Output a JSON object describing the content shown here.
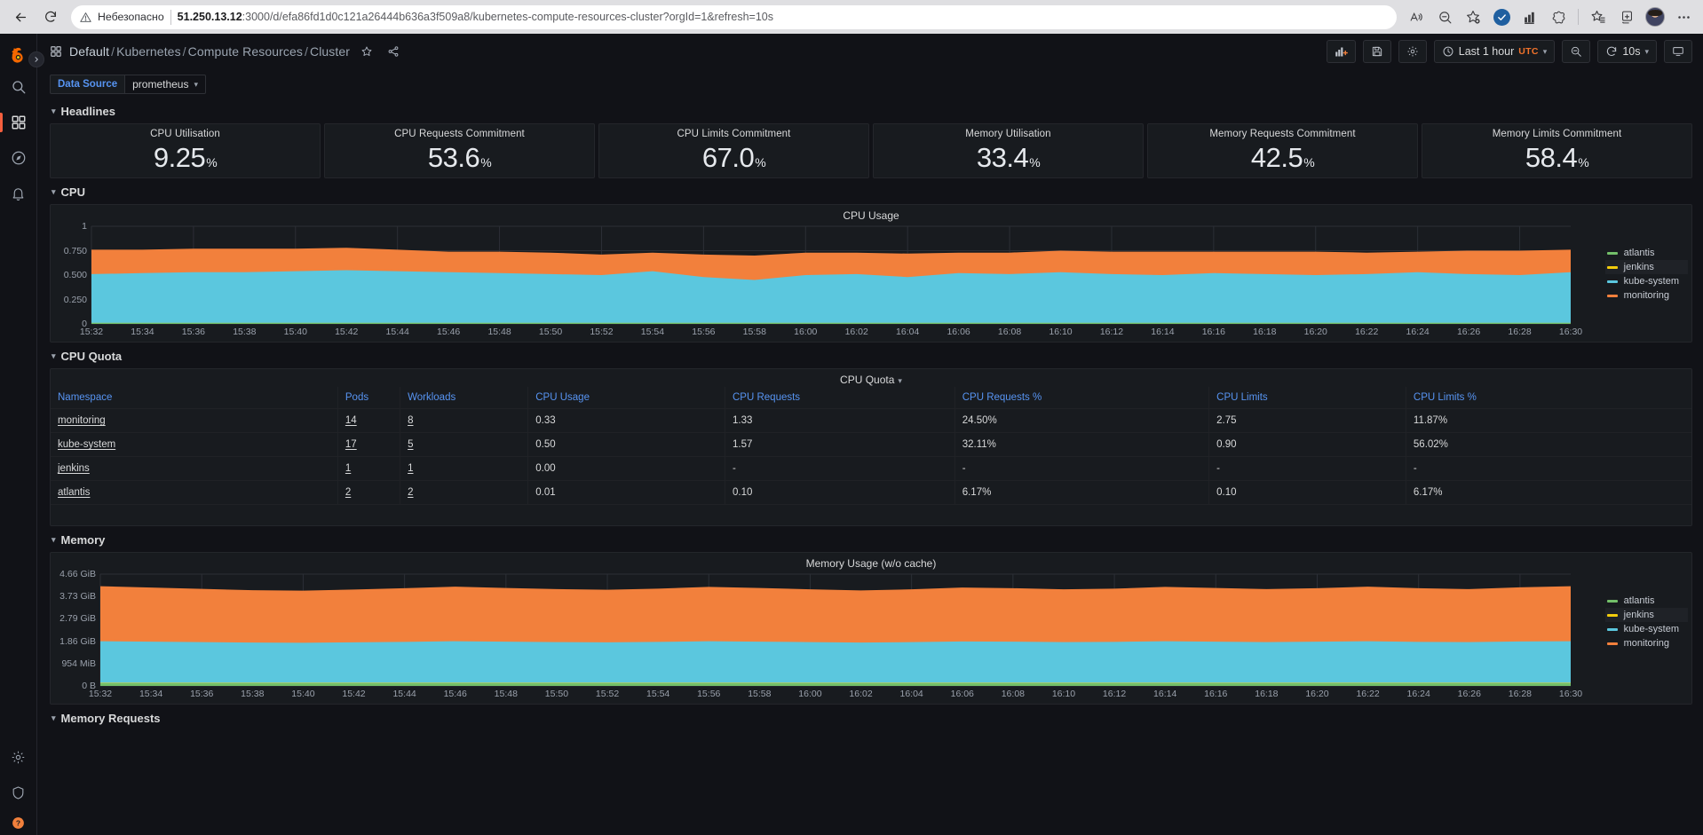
{
  "browser": {
    "insecure_label": "Небезопасно",
    "url_host": "51.250.13.12",
    "url_rest": ":3000/d/efa86fd1d0c121a26444b636a3f509a8/kubernetes-compute-resources-cluster?orgId=1&refresh=10s",
    "back_icon": "back-arrow-icon",
    "reload_icon": "reload-icon",
    "read_aloud_icon": "read-aloud-icon",
    "zoom_out_icon": "zoom-out-icon",
    "favorite_icon": "add-favorite-icon",
    "shield_icon": "tracking-prevention-icon",
    "collections_icon": "collections-icon",
    "browser_essentials_icon": "browser-essentials-icon",
    "split_screen_icon": "split-screen-icon",
    "profile_icon": "profile-avatar",
    "settings_icon": "settings-and-more-icon"
  },
  "sidebar": {
    "logo": "grafana-logo-icon",
    "expand_icon": "expand-menu-chevron-icon",
    "items": [
      {
        "name": "search",
        "icon": "search-icon",
        "active": false
      },
      {
        "name": "dashboards",
        "icon": "dashboards-grid-icon",
        "active": true
      },
      {
        "name": "explore",
        "icon": "compass-icon",
        "active": false
      },
      {
        "name": "alerting",
        "icon": "bell-icon",
        "active": false
      }
    ],
    "bottom_items": [
      {
        "name": "configuration",
        "icon": "gear-icon"
      },
      {
        "name": "server-admin",
        "icon": "shield-icon"
      },
      {
        "name": "help",
        "icon": "help-icon"
      }
    ]
  },
  "header": {
    "breadcrumb_icon": "dashboard-grid-icon",
    "breadcrumbs": [
      "Default",
      "Kubernetes",
      "Compute Resources",
      "Cluster"
    ],
    "star_icon": "star-icon",
    "share_icon": "share-icon",
    "toolbar": {
      "add_panel_icon": "add-panel-icon",
      "save_icon": "save-dashboard-icon",
      "settings_icon": "dashboard-settings-icon",
      "time_icon": "clock-icon",
      "time_range": "Last 1 hour",
      "timezone": "UTC",
      "zoom_out_icon": "zoom-out-time-icon",
      "refresh_icon": "refresh-icon",
      "refresh_interval": "10s",
      "tv_icon": "kiosk-mode-icon"
    }
  },
  "submenu": {
    "datasource_label": "Data Source",
    "datasource_value": "prometheus"
  },
  "rows": {
    "headlines": "Headlines",
    "cpu": "CPU",
    "cpu_quota": "CPU Quota",
    "memory": "Memory",
    "memory_requests": "Memory Requests"
  },
  "stats": [
    {
      "title": "CPU Utilisation",
      "value": "9.25",
      "unit": "%"
    },
    {
      "title": "CPU Requests Commitment",
      "value": "53.6",
      "unit": "%"
    },
    {
      "title": "CPU Limits Commitment",
      "value": "67.0",
      "unit": "%"
    },
    {
      "title": "Memory Utilisation",
      "value": "33.4",
      "unit": "%"
    },
    {
      "title": "Memory Requests Commitment",
      "value": "42.5",
      "unit": "%"
    },
    {
      "title": "Memory Limits Commitment",
      "value": "58.4",
      "unit": "%"
    }
  ],
  "cpu_table": {
    "title": "CPU Quota",
    "menu_icon": "panel-menu-chevron-icon",
    "columns": [
      "Namespace",
      "Pods",
      "Workloads",
      "CPU Usage",
      "CPU Requests",
      "CPU Requests %",
      "CPU Limits",
      "CPU Limits %"
    ],
    "rows": [
      {
        "namespace": "monitoring",
        "pods": "14",
        "workloads": "8",
        "cpu_usage": "0.33",
        "cpu_requests": "1.33",
        "cpu_requests_pct": "24.50%",
        "cpu_limits": "2.75",
        "cpu_limits_pct": "11.87%"
      },
      {
        "namespace": "kube-system",
        "pods": "17",
        "workloads": "5",
        "cpu_usage": "0.50",
        "cpu_requests": "1.57",
        "cpu_requests_pct": "32.11%",
        "cpu_limits": "0.90",
        "cpu_limits_pct": "56.02%"
      },
      {
        "namespace": "jenkins",
        "pods": "1",
        "workloads": "1",
        "cpu_usage": "0.00",
        "cpu_requests": "-",
        "cpu_requests_pct": "-",
        "cpu_limits": "-",
        "cpu_limits_pct": "-"
      },
      {
        "namespace": "atlantis",
        "pods": "2",
        "workloads": "2",
        "cpu_usage": "0.01",
        "cpu_requests": "0.10",
        "cpu_requests_pct": "6.17%",
        "cpu_limits": "0.10",
        "cpu_limits_pct": "6.17%"
      }
    ]
  },
  "chart_data": [
    {
      "id": "cpu_usage",
      "type": "area",
      "title": "CPU Usage",
      "xlabel": "",
      "ylabel": "",
      "ylim": [
        0,
        1
      ],
      "yticks": [
        "0",
        "0.250",
        "0.500",
        "0.750",
        "1"
      ],
      "ytick_values": [
        0,
        0.25,
        0.5,
        0.75,
        1
      ],
      "grid": true,
      "legend_position": "right",
      "stacked": true,
      "x": [
        "15:32",
        "15:34",
        "15:36",
        "15:38",
        "15:40",
        "15:42",
        "15:44",
        "15:46",
        "15:48",
        "15:50",
        "15:52",
        "15:54",
        "15:56",
        "15:58",
        "16:00",
        "16:02",
        "16:04",
        "16:06",
        "16:08",
        "16:10",
        "16:12",
        "16:14",
        "16:16",
        "16:18",
        "16:20",
        "16:22",
        "16:24",
        "16:26",
        "16:28",
        "16:30"
      ],
      "series": [
        {
          "name": "atlantis",
          "color": "#73bf69",
          "values": [
            0.01,
            0.01,
            0.01,
            0.01,
            0.01,
            0.01,
            0.01,
            0.01,
            0.01,
            0.01,
            0.01,
            0.01,
            0.01,
            0.01,
            0.01,
            0.01,
            0.01,
            0.01,
            0.01,
            0.01,
            0.01,
            0.01,
            0.01,
            0.01,
            0.01,
            0.01,
            0.01,
            0.01,
            0.01,
            0.01
          ]
        },
        {
          "name": "jenkins",
          "color": "#f2cc0c",
          "values": [
            0.0,
            0.0,
            0.0,
            0.0,
            0.0,
            0.0,
            0.0,
            0.0,
            0.0,
            0.0,
            0.0,
            0.0,
            0.0,
            0.0,
            0.0,
            0.0,
            0.0,
            0.0,
            0.0,
            0.0,
            0.0,
            0.0,
            0.0,
            0.0,
            0.0,
            0.0,
            0.0,
            0.0,
            0.0,
            0.0
          ]
        },
        {
          "name": "kube-system",
          "color": "#5bc7de",
          "values": [
            0.5,
            0.51,
            0.52,
            0.52,
            0.53,
            0.54,
            0.53,
            0.52,
            0.51,
            0.5,
            0.49,
            0.53,
            0.47,
            0.44,
            0.49,
            0.5,
            0.47,
            0.51,
            0.5,
            0.52,
            0.5,
            0.49,
            0.51,
            0.5,
            0.49,
            0.5,
            0.52,
            0.5,
            0.49,
            0.52
          ]
        },
        {
          "name": "monitoring",
          "color": "#f2803c",
          "values": [
            0.25,
            0.24,
            0.24,
            0.24,
            0.23,
            0.23,
            0.22,
            0.21,
            0.22,
            0.22,
            0.21,
            0.19,
            0.23,
            0.25,
            0.23,
            0.22,
            0.24,
            0.21,
            0.22,
            0.22,
            0.23,
            0.24,
            0.22,
            0.23,
            0.24,
            0.22,
            0.21,
            0.24,
            0.25,
            0.23
          ]
        }
      ]
    },
    {
      "id": "memory_usage",
      "type": "area",
      "title": "Memory Usage (w/o cache)",
      "xlabel": "",
      "ylabel": "",
      "yticks": [
        "0 B",
        "954 MiB",
        "1.86 GiB",
        "2.79 GiB",
        "3.73 GiB",
        "4.66 GiB"
      ],
      "ytick_values": [
        0,
        1,
        2,
        3,
        4,
        5
      ],
      "grid": true,
      "legend_position": "right",
      "stacked": true,
      "x": [
        "15:32",
        "15:34",
        "15:36",
        "15:38",
        "15:40",
        "15:42",
        "15:44",
        "15:46",
        "15:48",
        "15:50",
        "15:52",
        "15:54",
        "15:56",
        "15:58",
        "16:00",
        "16:02",
        "16:04",
        "16:06",
        "16:08",
        "16:10",
        "16:12",
        "16:14",
        "16:16",
        "16:18",
        "16:20",
        "16:22",
        "16:24",
        "16:26",
        "16:28",
        "16:30"
      ],
      "series": [
        {
          "name": "atlantis",
          "color": "#73bf69",
          "values": [
            0.12,
            0.12,
            0.12,
            0.12,
            0.12,
            0.12,
            0.12,
            0.12,
            0.12,
            0.12,
            0.12,
            0.12,
            0.12,
            0.12,
            0.12,
            0.12,
            0.12,
            0.12,
            0.12,
            0.12,
            0.12,
            0.12,
            0.12,
            0.12,
            0.12,
            0.12,
            0.12,
            0.12,
            0.12,
            0.12
          ]
        },
        {
          "name": "jenkins",
          "color": "#f2cc0c",
          "values": [
            0.02,
            0.02,
            0.02,
            0.02,
            0.02,
            0.02,
            0.02,
            0.02,
            0.02,
            0.02,
            0.02,
            0.02,
            0.02,
            0.02,
            0.02,
            0.02,
            0.02,
            0.02,
            0.02,
            0.02,
            0.02,
            0.02,
            0.02,
            0.02,
            0.02,
            0.02,
            0.02,
            0.02,
            0.02,
            0.02
          ]
        },
        {
          "name": "kube-system",
          "color": "#5bc7de",
          "values": [
            1.86,
            1.84,
            1.82,
            1.8,
            1.79,
            1.81,
            1.83,
            1.86,
            1.84,
            1.82,
            1.81,
            1.83,
            1.86,
            1.84,
            1.82,
            1.8,
            1.82,
            1.85,
            1.84,
            1.82,
            1.83,
            1.86,
            1.84,
            1.82,
            1.84,
            1.86,
            1.83,
            1.82,
            1.85,
            1.86
          ]
        },
        {
          "name": "monitoring",
          "color": "#f2803c",
          "values": [
            2.46,
            2.42,
            2.38,
            2.34,
            2.33,
            2.36,
            2.4,
            2.44,
            2.4,
            2.37,
            2.35,
            2.38,
            2.43,
            2.4,
            2.36,
            2.33,
            2.36,
            2.41,
            2.39,
            2.36,
            2.38,
            2.43,
            2.4,
            2.37,
            2.39,
            2.44,
            2.4,
            2.37,
            2.42,
            2.46
          ]
        }
      ]
    }
  ],
  "colors": {
    "accent_orange": "#f2803c",
    "accent_cyan": "#5bc7de",
    "accent_green": "#73bf69",
    "accent_yellow": "#f2cc0c",
    "link_blue": "#5794f2",
    "panel_bg": "#181b1f",
    "page_bg": "#111217"
  }
}
